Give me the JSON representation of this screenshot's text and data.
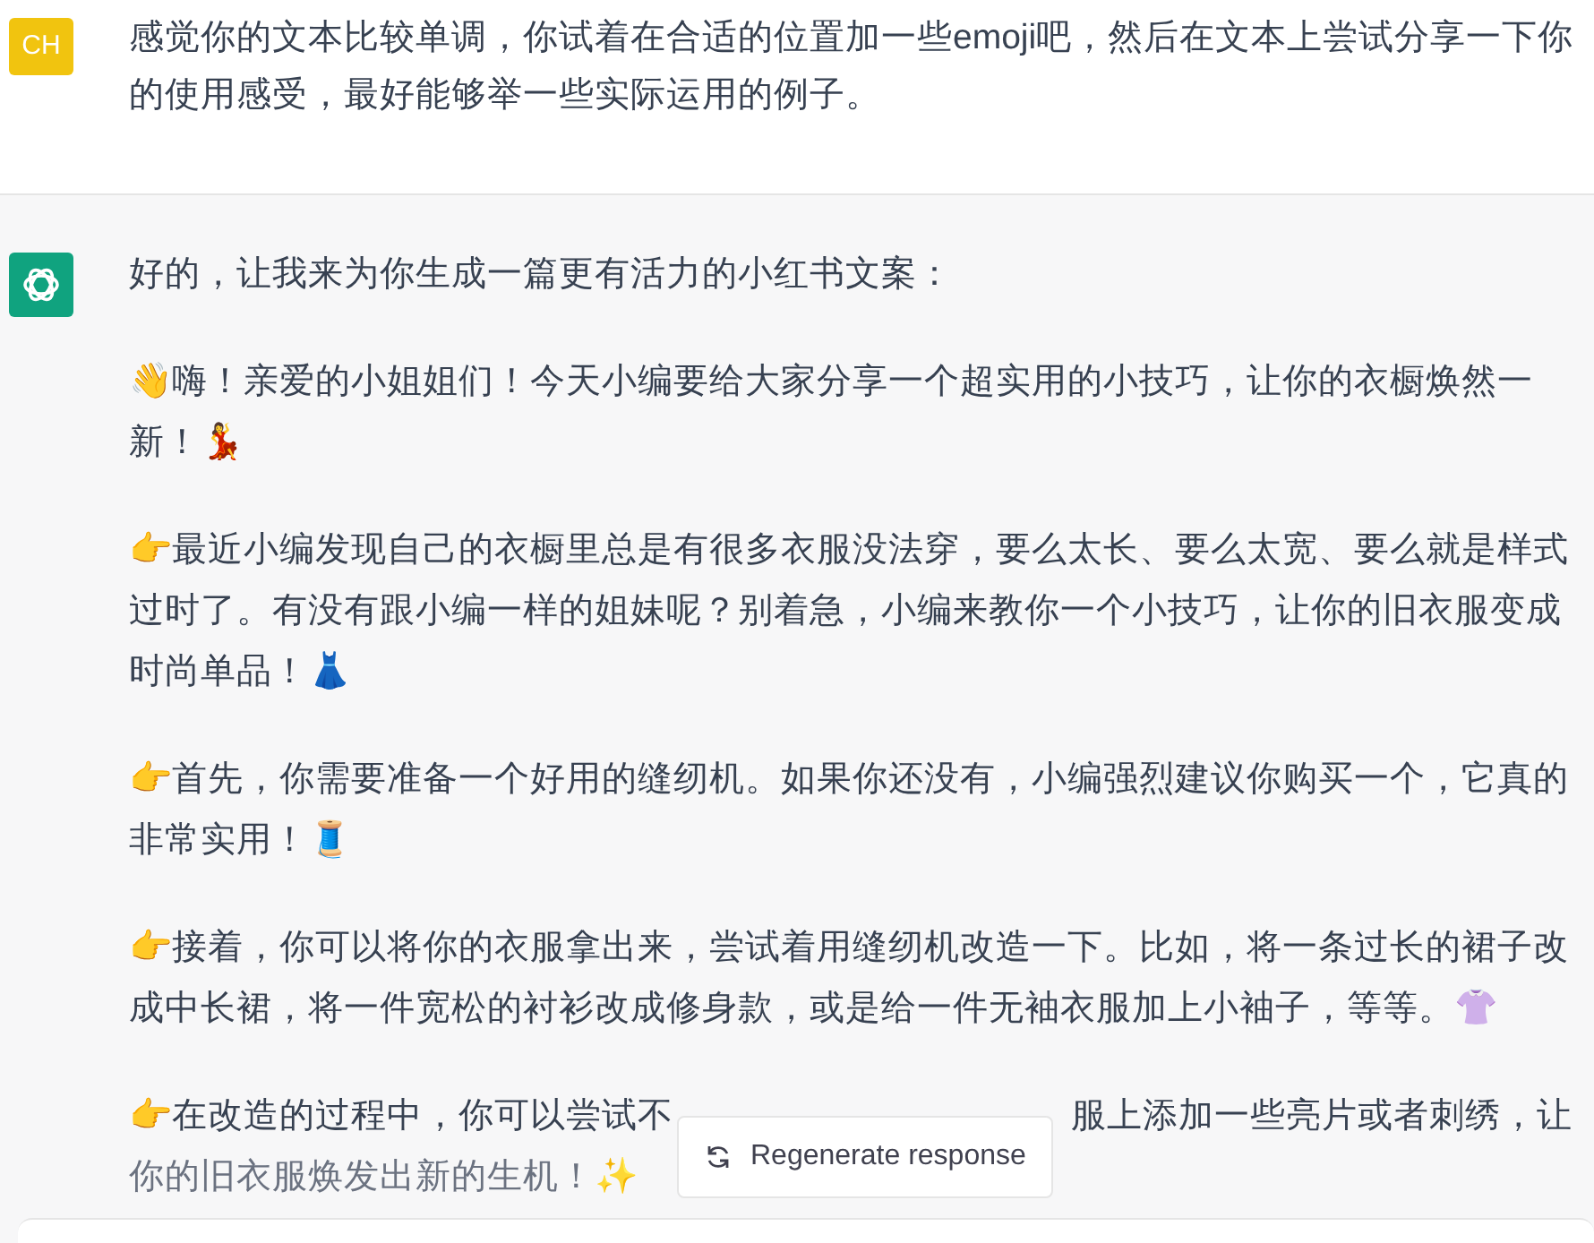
{
  "user_message": {
    "avatar": "CH",
    "text": "感觉你的文本比较单调，你试着在合适的位置加一些emoji吧，然后在文本上尝试分享一下你的使用感受，最好能够举一些实际运用的例子。"
  },
  "assistant_message": {
    "intro": "好的，让我来为你生成一篇更有活力的小红书文案：",
    "paragraphs": [
      {
        "text": "👋嗨！亲爱的小姐姐们！今天小编要给大家分享一个超实用的小技巧，让你的衣橱焕然一新！💃"
      },
      {
        "text": "👉最近小编发现自己的衣橱里总是有很多衣服没法穿，要么太长、要么太宽、要么就是样式过时了。有没有跟小编一样的姐妹呢？别着急，小编来教你一个小技巧，让你的旧衣服变成时尚单品！👗"
      },
      {
        "text": "👉首先，你需要准备一个好用的缝纫机。如果你还没有，小编强烈建议你购买一个，它真的非常实用！🧵"
      },
      {
        "text": "👉接着，你可以将你的衣服拿出来，尝试着用缝纫机改造一下。比如，将一条过长的裙子改成中长裙，将一件宽松的衬衫改成修身款，或是给一件无袖衣服加上小袖子，等等。👚"
      }
    ],
    "partly_covered_paragraph": {
      "before_button": "👉在改造的过程中，你可以尝试不",
      "after_button": "服上添加一些亮片或者刺绣，让",
      "last_line": "你的旧衣服焕发出新的生机！✨"
    }
  },
  "regenerate_button": {
    "label": "Regenerate response"
  }
}
